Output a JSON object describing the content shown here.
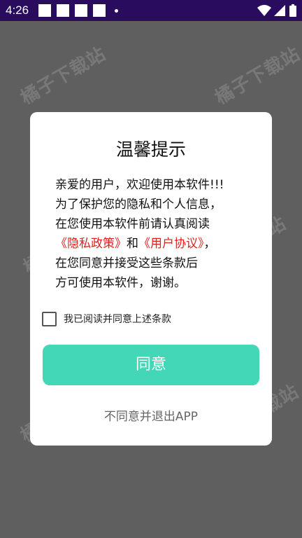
{
  "status_bar": {
    "time": "4:26",
    "icons": [
      "notification-box-icon",
      "notification-box-icon",
      "notification-box-icon",
      "notification-box-icon",
      "dot-icon",
      "wifi-icon",
      "signal-icon",
      "battery-icon"
    ]
  },
  "watermark": {
    "text": "橘子下载站"
  },
  "dialog": {
    "title": "温馨提示",
    "body": {
      "line1": "亲爱的用户，欢迎使用本软件!!!",
      "line2": "为了保护您的隐私和个人信息，",
      "line3": "在您使用本软件前请认真阅读",
      "privacy_link": "《隐私政策》",
      "and": "和",
      "agreement_link": "《用户协议》",
      "comma": "，",
      "line5": "在您同意并接受这些条款后",
      "line6": "方可使用本软件，谢谢。"
    },
    "checkbox": {
      "label": "我已阅读并同意上述条款",
      "checked": false
    },
    "agree_button": "同意",
    "decline_link": "不同意并退出APP"
  },
  "colors": {
    "accent": "#43d7b7",
    "link": "#e02020",
    "status_bar": "#2a0c5e",
    "overlay": "#5f5f5f"
  }
}
